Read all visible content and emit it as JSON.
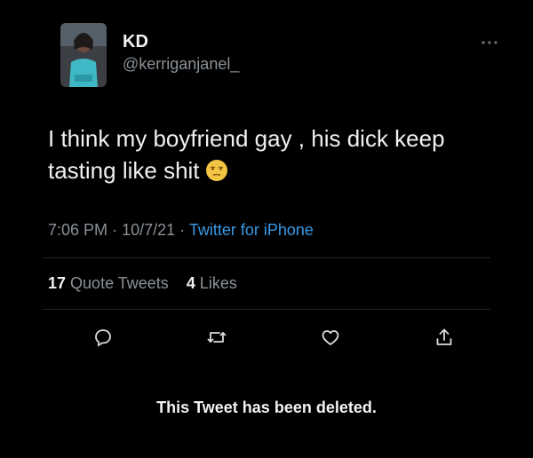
{
  "tweet": {
    "author": {
      "display_name": "KD",
      "handle": "@kerriganjanel_",
      "avatar_icon": "user-avatar"
    },
    "text": "I think my boyfriend gay , his dick keep tasting like shit",
    "emoji": "unamused-face-emoji",
    "meta": {
      "time": "7:06 PM",
      "date": "10/7/21",
      "separator": "·",
      "source": "Twitter for iPhone"
    },
    "stats": {
      "quote_count": "17",
      "quote_label": "Quote Tweets",
      "like_count": "4",
      "like_label": "Likes"
    },
    "actions": [
      "reply-icon",
      "retweet-icon",
      "like-icon",
      "share-icon"
    ],
    "more_icon": "more-options-icon"
  },
  "quoted": {
    "deleted_message": "This Tweet has been deleted."
  },
  "colors": {
    "background": "#000000",
    "text": "#e7e9ea",
    "secondary": "#8b9198",
    "link": "#3a9ae6",
    "divider": "#24272a"
  }
}
